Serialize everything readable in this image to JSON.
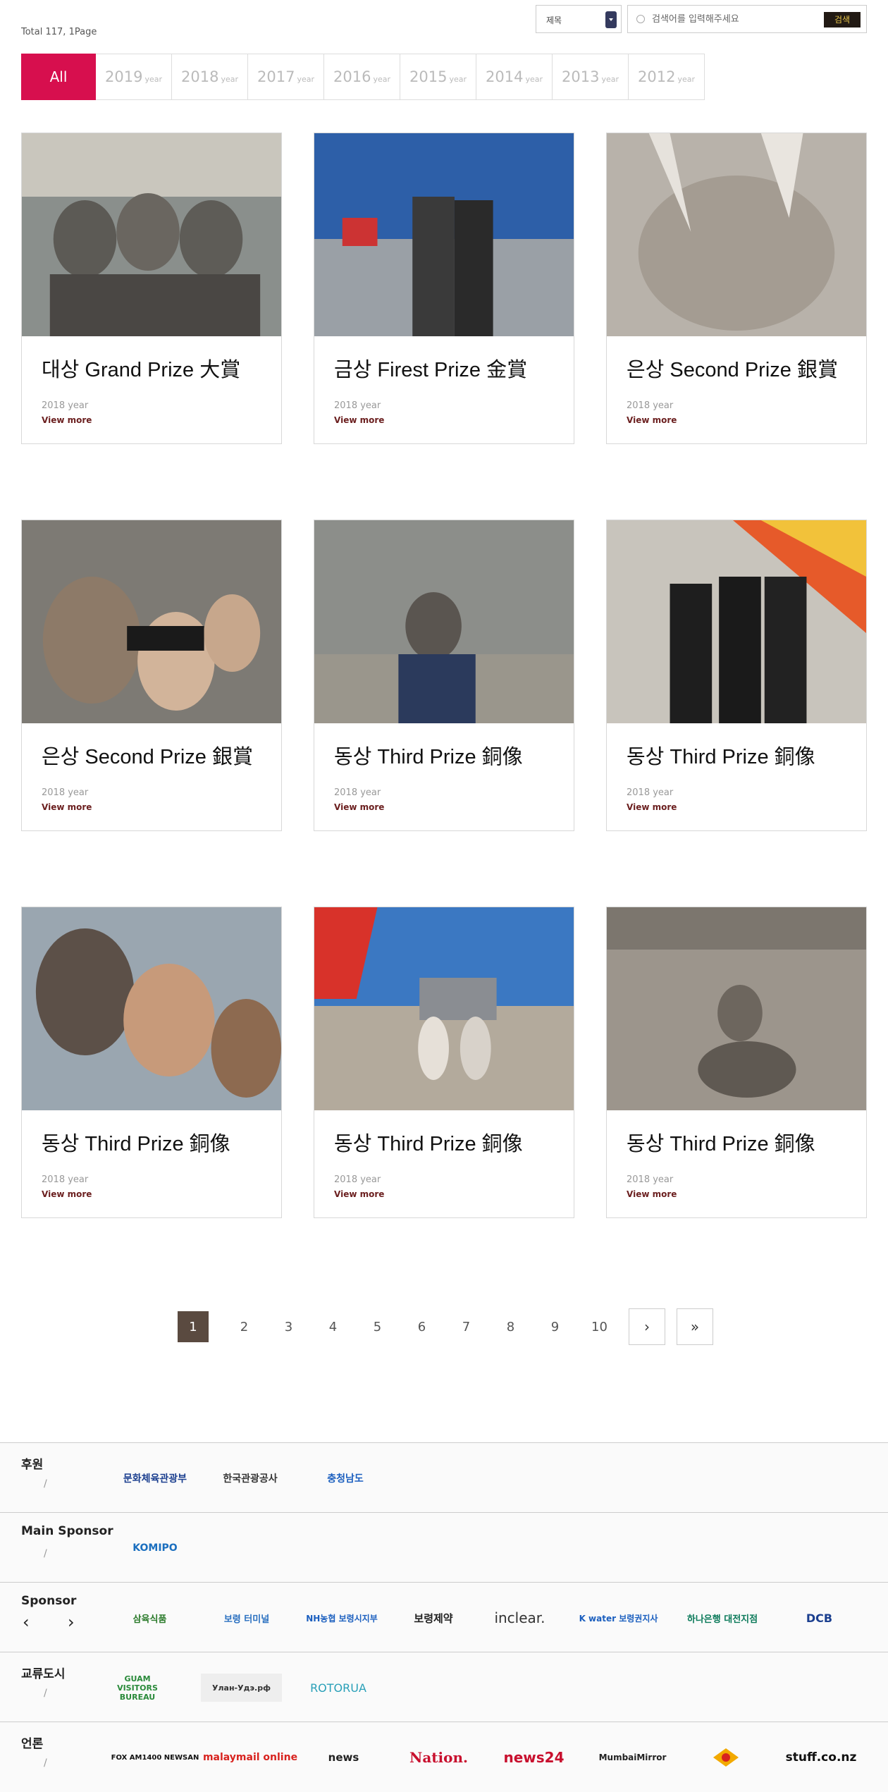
{
  "summary": "Total 117, 1Page",
  "search": {
    "select_value": "제목",
    "placeholder": "검색어를 입력해주세요",
    "button": "검색"
  },
  "year_tabs": [
    {
      "label": "All",
      "suffix": ""
    },
    {
      "label": "2019",
      "suffix": "year"
    },
    {
      "label": "2018",
      "suffix": "year"
    },
    {
      "label": "2017",
      "suffix": "year"
    },
    {
      "label": "2016",
      "suffix": "year"
    },
    {
      "label": "2015",
      "suffix": "year"
    },
    {
      "label": "2014",
      "suffix": "year"
    },
    {
      "label": "2013",
      "suffix": "year"
    },
    {
      "label": "2012",
      "suffix": "year"
    }
  ],
  "cards": [
    {
      "title": "대상 Grand Prize 大賞",
      "year": "2018 year",
      "more": "View more"
    },
    {
      "title": "금상 Firest Prize 金賞",
      "year": "2018 year",
      "more": "View more"
    },
    {
      "title": "은상 Second Prize 銀賞",
      "year": "2018 year",
      "more": "View more"
    },
    {
      "title": "은상 Second Prize 銀賞",
      "year": "2018 year",
      "more": "View more"
    },
    {
      "title": "동상 Third Prize 銅像",
      "year": "2018 year",
      "more": "View more"
    },
    {
      "title": "동상 Third Prize 銅像",
      "year": "2018 year",
      "more": "View more"
    },
    {
      "title": "동상 Third Prize 銅像",
      "year": "2018 year",
      "more": "View more"
    },
    {
      "title": "동상 Third Prize 銅像",
      "year": "2018 year",
      "more": "View more"
    },
    {
      "title": "동상 Third Prize 銅像",
      "year": "2018 year",
      "more": "View more"
    }
  ],
  "pagination": {
    "pages": [
      "1",
      "2",
      "3",
      "4",
      "5",
      "6",
      "7",
      "8",
      "9",
      "10"
    ],
    "current": "1",
    "next": "›",
    "last": "»"
  },
  "footer": {
    "sections": [
      {
        "label": "후원",
        "logos": [
          "문화체육관광부",
          "한국관광공사",
          "충청남도"
        ]
      },
      {
        "label": "Main Sponsor",
        "logos": [
          "KOMIPO"
        ]
      },
      {
        "label": "Sponsor",
        "logos": [
          "삼육식품",
          "보령 터미널",
          "NH농협 보령시지부",
          "보령제약",
          "inclear.",
          "K water 보령권지사",
          "하나은행 대전지점",
          "DCB"
        ]
      },
      {
        "label": "교류도시",
        "logos": [
          "GUAM VISITORS BUREAU",
          "Улан-Удэ.рф",
          "ROTORUA"
        ]
      },
      {
        "label": "언론",
        "logos": [
          "FOX AM1400 NEWSAN",
          "malaymail online",
          "news",
          "Nation.",
          "news24",
          "MumbaiMirror",
          "",
          "stuff.co.nz"
        ]
      }
    ],
    "slash": "/",
    "sponsor_prev": "‹",
    "sponsor_next": "›"
  },
  "colors": {
    "accent": "#d70f4e",
    "pagination_active": "#5a4a40",
    "link": "#6b1f1f"
  }
}
